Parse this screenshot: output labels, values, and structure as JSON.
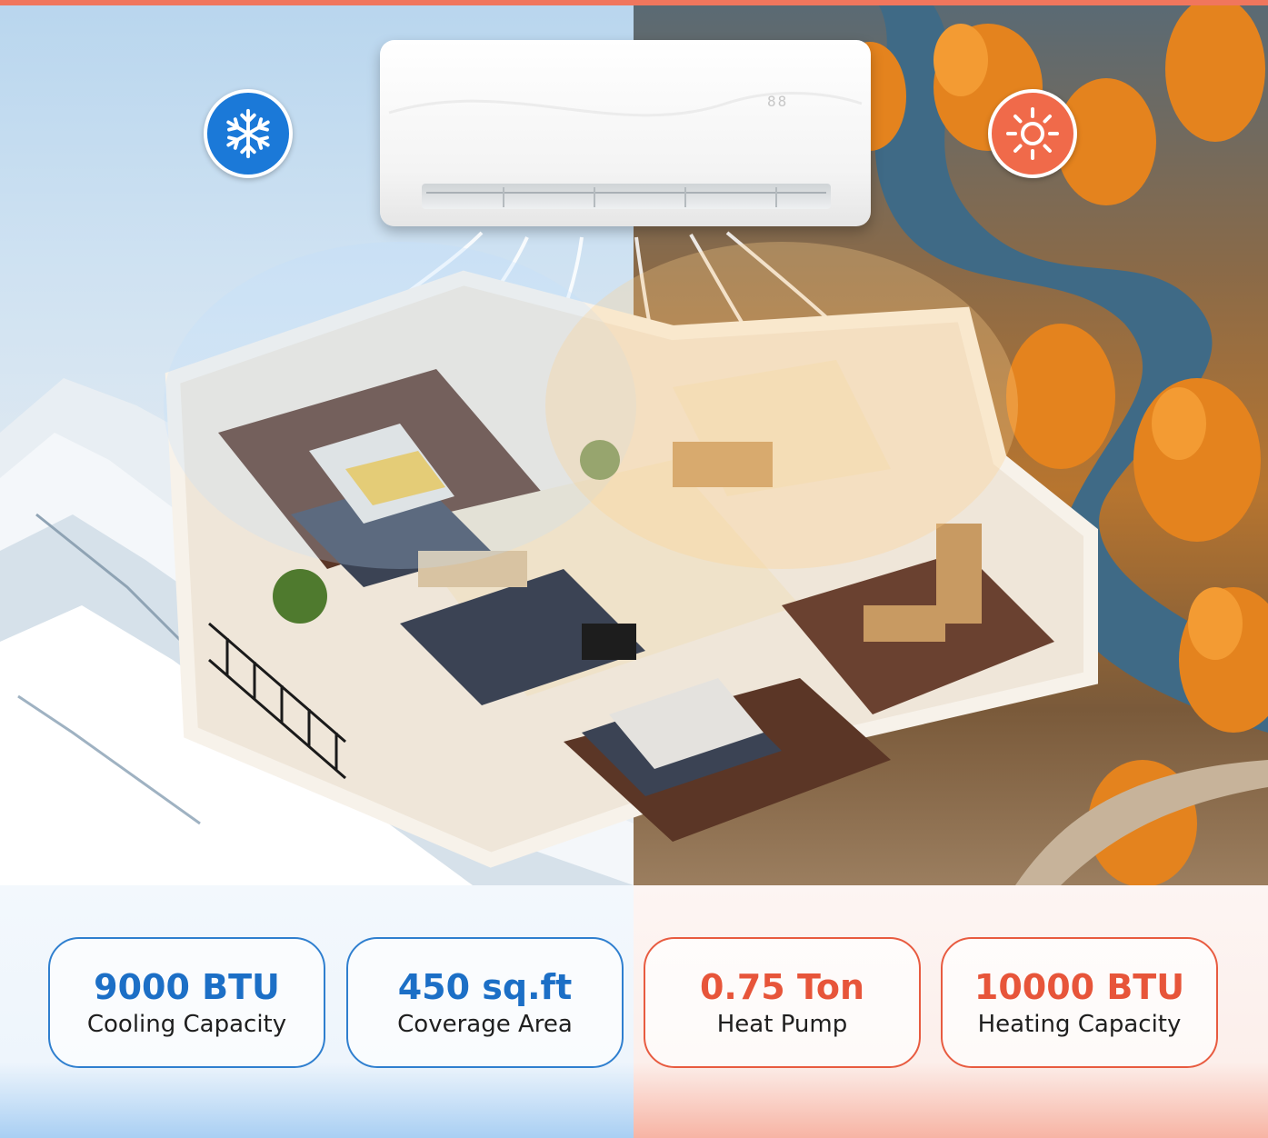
{
  "colors": {
    "cool_accent": "#1b79d8",
    "heat_accent": "#f06a4a",
    "cool_text": "#1c6fc6",
    "heat_text": "#e7553a"
  },
  "icons": {
    "cooling": "snowflake-icon",
    "heating": "sun-icon"
  },
  "specs": [
    {
      "value": "9000 BTU",
      "label": "Cooling Capacity",
      "theme": "cool"
    },
    {
      "value": "450 sq.ft",
      "label": "Coverage Area",
      "theme": "cool"
    },
    {
      "value": "0.75 Ton",
      "label": "Heat Pump",
      "theme": "heat"
    },
    {
      "value": "10000 BTU",
      "label": "Heating Capacity",
      "theme": "heat"
    }
  ]
}
